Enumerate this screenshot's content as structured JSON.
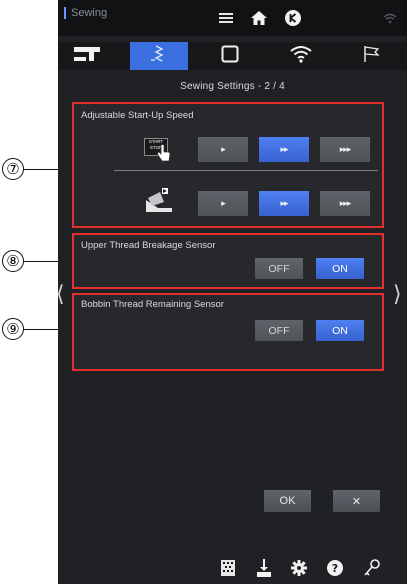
{
  "status_bar": {
    "app_title": "Sewing",
    "icons": [
      "menu-icon",
      "home-icon",
      "k-logo-icon",
      "wifi-icon"
    ]
  },
  "tabs": [
    {
      "name": "sewing-machine-tab",
      "icon": "sewing-machine-icon"
    },
    {
      "name": "stitch-tab",
      "icon": "stitch-icon",
      "active": true
    },
    {
      "name": "frame-tab",
      "icon": "square-icon"
    },
    {
      "name": "wireless-tab",
      "icon": "wifi-icon"
    },
    {
      "name": "flag-tab",
      "icon": "flag-icon"
    }
  ],
  "page_title": "Sewing Settings - 2 / 4",
  "panels": {
    "speed": {
      "label": "Adjustable Start-Up Speed",
      "start_stop_label": "START STOP",
      "rows": [
        {
          "icon": "start-stop-button-icon",
          "buttons": [
            "▸",
            "▸▸",
            "▸▸▸"
          ],
          "selected": 1
        },
        {
          "icon": "foot-pedal-icon",
          "buttons": [
            "▸",
            "▸▸",
            "▸▸▸"
          ],
          "selected": 1
        }
      ]
    },
    "upper_thread": {
      "label": "Upper Thread Breakage Sensor",
      "off_label": "OFF",
      "on_label": "ON",
      "selected": "ON"
    },
    "bobbin_thread": {
      "label": "Bobbin Thread Remaining Sensor",
      "off_label": "OFF",
      "on_label": "ON",
      "selected": "ON"
    }
  },
  "footer": {
    "ok_label": "OK",
    "cancel_label": "✕"
  },
  "bottom_bar": {
    "icons": [
      "bobbin-winder-icon",
      "needle-threader-icon",
      "settings-gear-icon",
      "help-icon",
      "key-icon"
    ]
  },
  "callouts": {
    "speed": "⑦",
    "upper_thread": "⑧",
    "bobbin_thread": "⑨"
  },
  "nav": {
    "prev": "⟨",
    "next": "⟩"
  },
  "colors": {
    "accent": "#3b6fe0",
    "highlight": "#e1312f",
    "background": "#202124"
  }
}
